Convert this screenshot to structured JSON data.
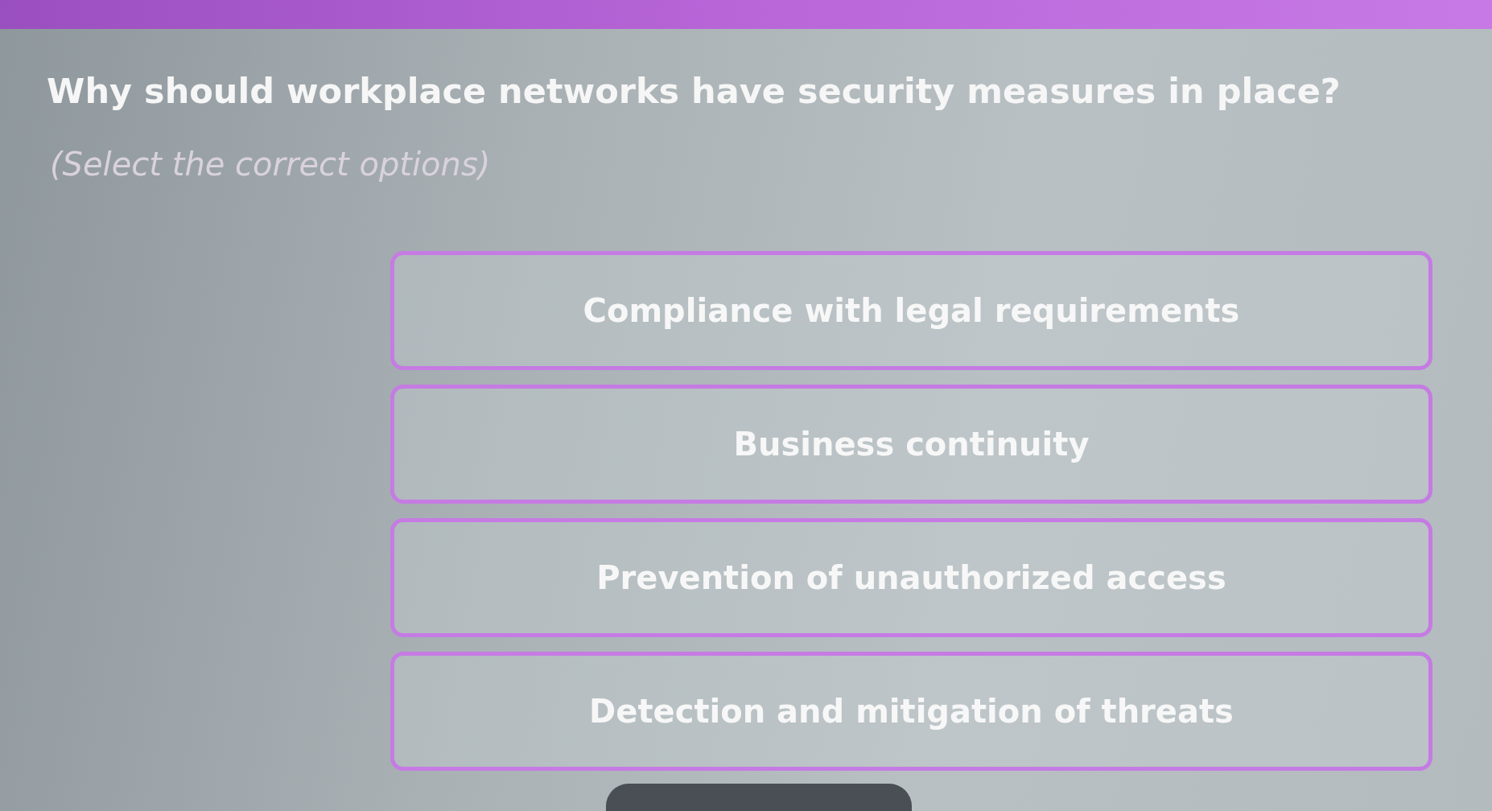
{
  "question": {
    "title": "Why should workplace networks have security measures in place?",
    "instruction": "(Select the correct options)"
  },
  "options": [
    {
      "label": "Compliance with legal requirements",
      "selected": false
    },
    {
      "label": "Business continuity",
      "selected": false
    },
    {
      "label": "Prevention of unauthorized access",
      "selected": false
    },
    {
      "label": "Detection and mitigation of threats",
      "selected": false
    }
  ]
}
